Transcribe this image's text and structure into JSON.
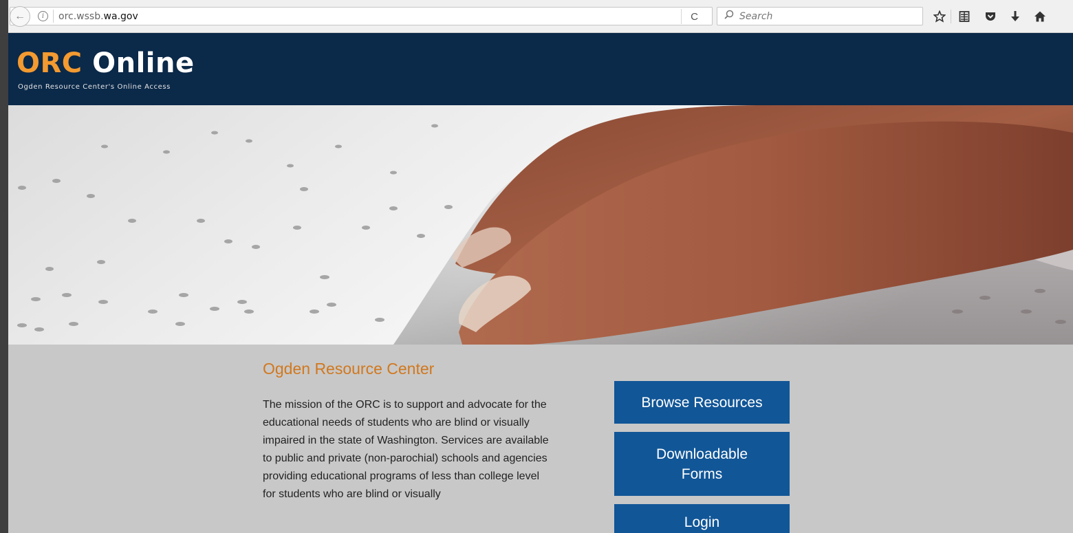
{
  "browser": {
    "url_prefix": "orc.wssb.",
    "url_domain": "wa.gov",
    "search_placeholder": "Search",
    "info_glyph": "i",
    "back_glyph": "←",
    "reload_glyph": "C",
    "search_glyph": "⚲",
    "icons": [
      "star-icon",
      "reading-list-icon",
      "pocket-icon",
      "download-icon",
      "home-icon"
    ]
  },
  "header": {
    "logo_orc": "ORC",
    "logo_online": "Online",
    "tagline": "Ogden Resource Center's Online Access",
    "colors": {
      "background": "#0b2949",
      "accent": "#f39a30"
    }
  },
  "main": {
    "title": "Ogden Resource Center",
    "body": "The mission of the ORC is to support and advocate for the educational needs of students who are blind or visually impaired in the state of Washington. Services are available to public and private (non-parochial) schools and agencies providing educational programs of less than college level for students who are blind or visually"
  },
  "actions": {
    "browse_label": "Browse Resources",
    "forms_label": "Downloadable Forms",
    "login_label": "Login",
    "button_color": "#115697"
  }
}
